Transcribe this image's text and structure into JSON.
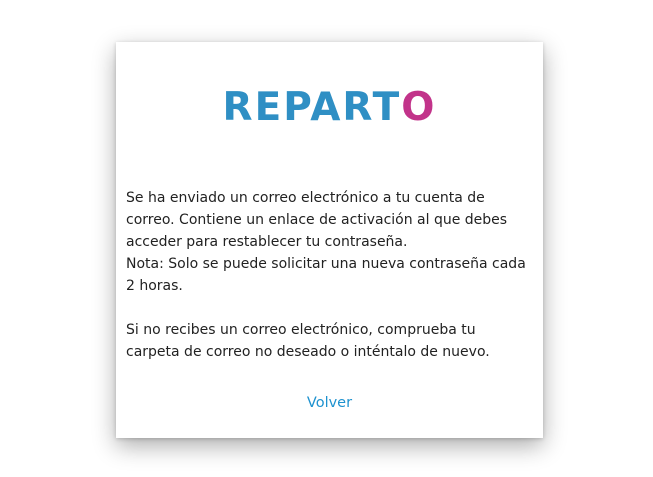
{
  "logo": {
    "text_main": "REPART",
    "text_accent": "O",
    "color_main": "#2f8fc4",
    "color_accent": "#c2338a"
  },
  "message": {
    "line_1": "Se ha enviado un correo electrónico a tu cuenta de correo. Contiene un enlace de activación al que debes acceder para restablecer tu contraseña.",
    "line_2": "Nota: Solo se puede solicitar una nueva contraseña cada 2 horas.",
    "line_3": "Si no recibes un correo electrónico, comprueba tu carpeta de correo no deseado o inténtalo de nuevo."
  },
  "back_link": {
    "label": "Volver",
    "color": "#1e92cf"
  }
}
